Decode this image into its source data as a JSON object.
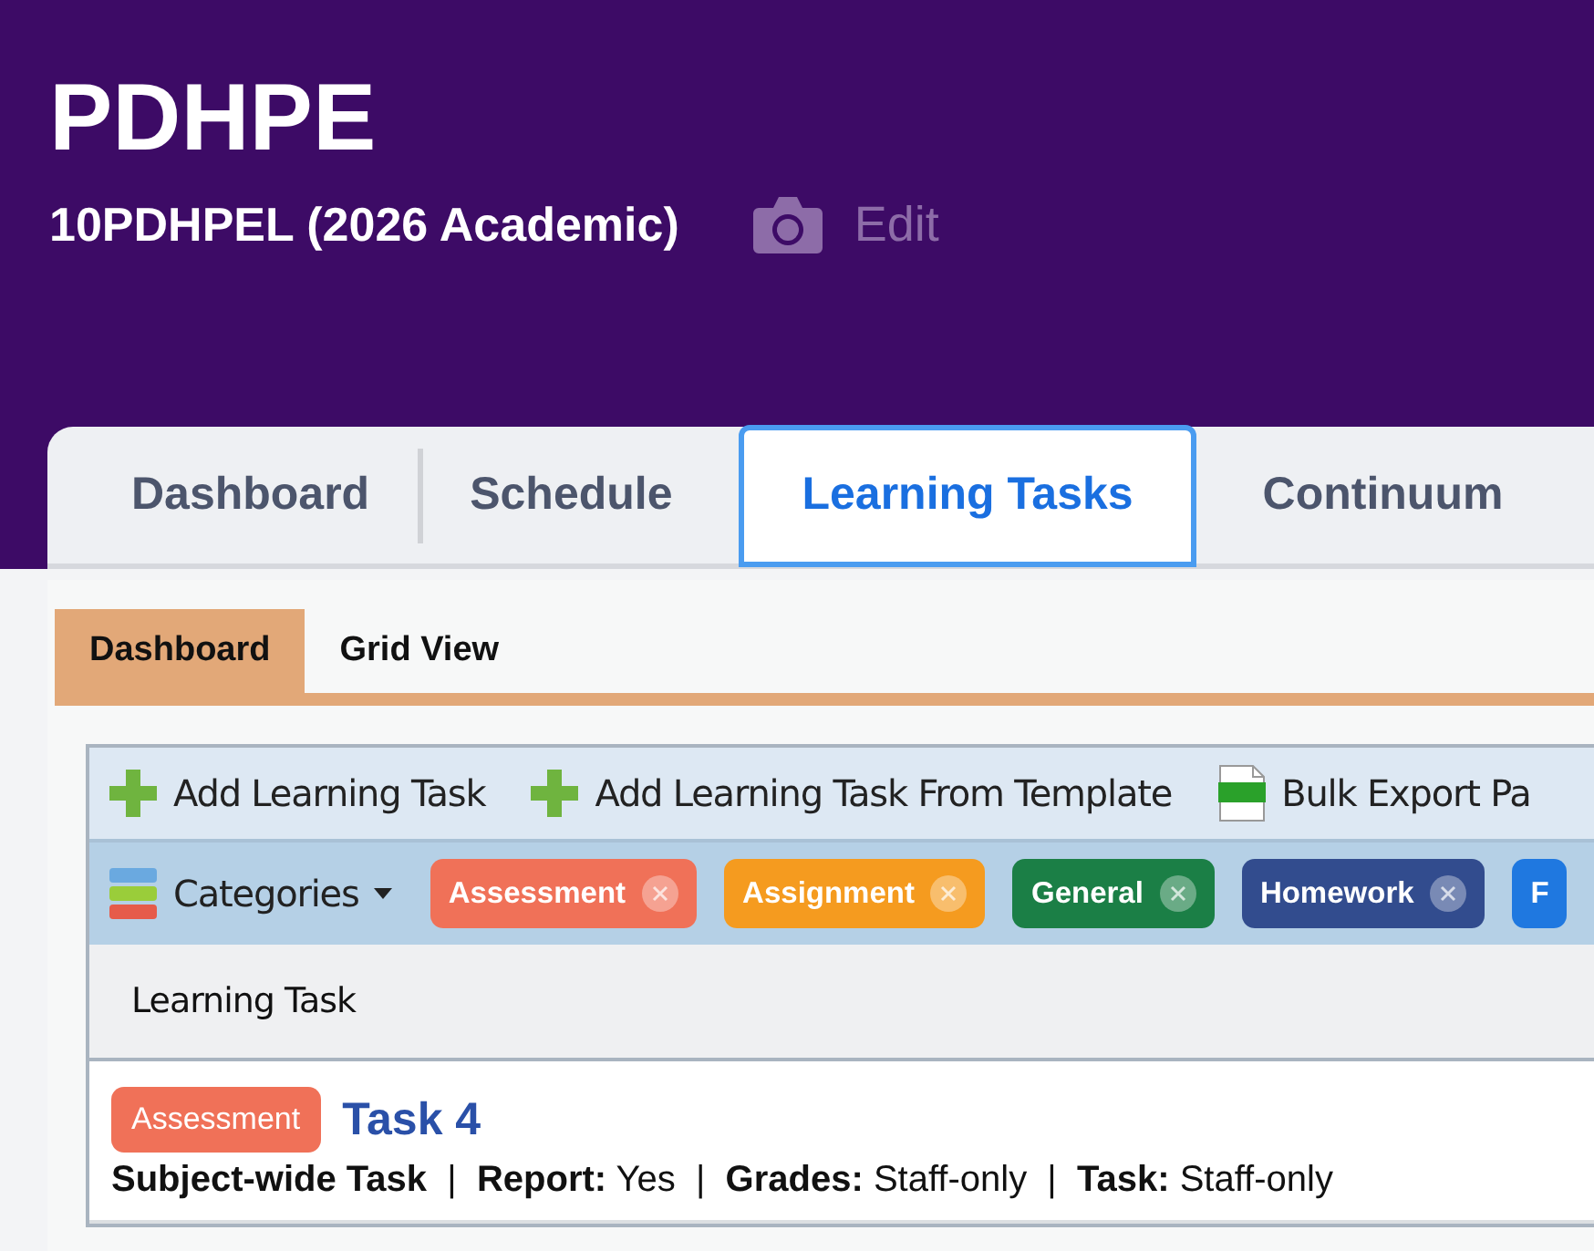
{
  "header": {
    "title": "PDHPE",
    "subtitle": "10PDHPEL (2026 Academic)",
    "edit_label": "Edit"
  },
  "tabs": [
    {
      "label": "Dashboard",
      "selected": false
    },
    {
      "label": "Schedule",
      "selected": false
    },
    {
      "label": "Learning Tasks",
      "selected": true
    },
    {
      "label": "Continuum",
      "selected": false
    }
  ],
  "subtabs": [
    {
      "label": "Dashboard",
      "selected": true
    },
    {
      "label": "Grid View",
      "selected": false
    }
  ],
  "toolbar": [
    {
      "kind": "add",
      "label": "Add Learning Task"
    },
    {
      "kind": "add",
      "label": "Add Learning Task From Template"
    },
    {
      "kind": "csv",
      "label": "Bulk Export Pa"
    }
  ],
  "categories_label": "Categories",
  "categories": [
    {
      "label": "Assessment",
      "color": "#f07158"
    },
    {
      "label": "Assignment",
      "color": "#f59b1f"
    },
    {
      "label": "General",
      "color": "#1b7f46"
    },
    {
      "label": "Homework",
      "color": "#324c8e"
    },
    {
      "label": "F",
      "color": "#1f78e0"
    }
  ],
  "table": {
    "column": "Learning Task",
    "rows": [
      {
        "category": {
          "label": "Assessment",
          "color": "#f07158"
        },
        "title": "Task 4",
        "details": "**Subject-wide Task**  |  **Report:** Yes  |  **Grades:** Staff-only  |  **Task:** Staff-only"
      }
    ]
  }
}
